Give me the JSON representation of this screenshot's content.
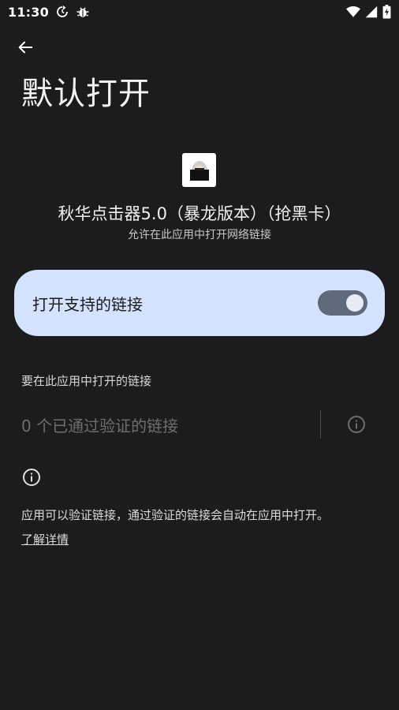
{
  "status_bar": {
    "time": "11:30",
    "icons": [
      "sync-icon",
      "bug-icon",
      "wifi-icon",
      "signal-icon",
      "battery-icon"
    ]
  },
  "header": {
    "back_icon": "arrow-back-icon",
    "title": "默认打开"
  },
  "app": {
    "name": "秋华点击器5.0（暴龙版本）（抢黑卡）",
    "subtitle": "允许在此应用中打开网络链接"
  },
  "toggle": {
    "label": "打开支持的链接",
    "enabled": true,
    "card_color": "#d3e3fd",
    "track_color": "#5f6b7a"
  },
  "links_section": {
    "label": "要在此应用中打开的链接",
    "count_text": "0 个已通过验证的链接",
    "info_icon": "info-icon"
  },
  "footer": {
    "info_icon": "info-icon",
    "text": "应用可以验证链接，通过验证的链接会自动在应用中打开。",
    "learn_more": "了解详情"
  }
}
